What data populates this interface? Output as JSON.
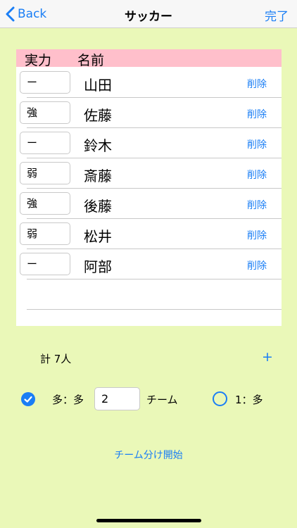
{
  "nav": {
    "back_label": "Back",
    "title": "サッカー",
    "done_label": "完了"
  },
  "table": {
    "header_strength": "実力",
    "header_name": "名前",
    "delete_label": "削除",
    "rows": [
      {
        "strength": "ー",
        "name": "山田"
      },
      {
        "strength": "強",
        "name": "佐藤"
      },
      {
        "strength": "ー",
        "name": "鈴木"
      },
      {
        "strength": "弱",
        "name": "斎藤"
      },
      {
        "strength": "強",
        "name": "後藤"
      },
      {
        "strength": "弱",
        "name": "松井"
      },
      {
        "strength": "ー",
        "name": "阿部"
      }
    ]
  },
  "summary": {
    "total_label": "計 7人",
    "add_label": "+"
  },
  "mode": {
    "many_label": "多：多",
    "team_count": "2",
    "team_label": "チーム",
    "one_label": "1：多",
    "selected": "many"
  },
  "action": {
    "start_label": "チーム分け開始"
  },
  "colors": {
    "accent": "#1a7ef5",
    "background": "#eaf8b8",
    "header_bg": "#ffbfcb"
  }
}
